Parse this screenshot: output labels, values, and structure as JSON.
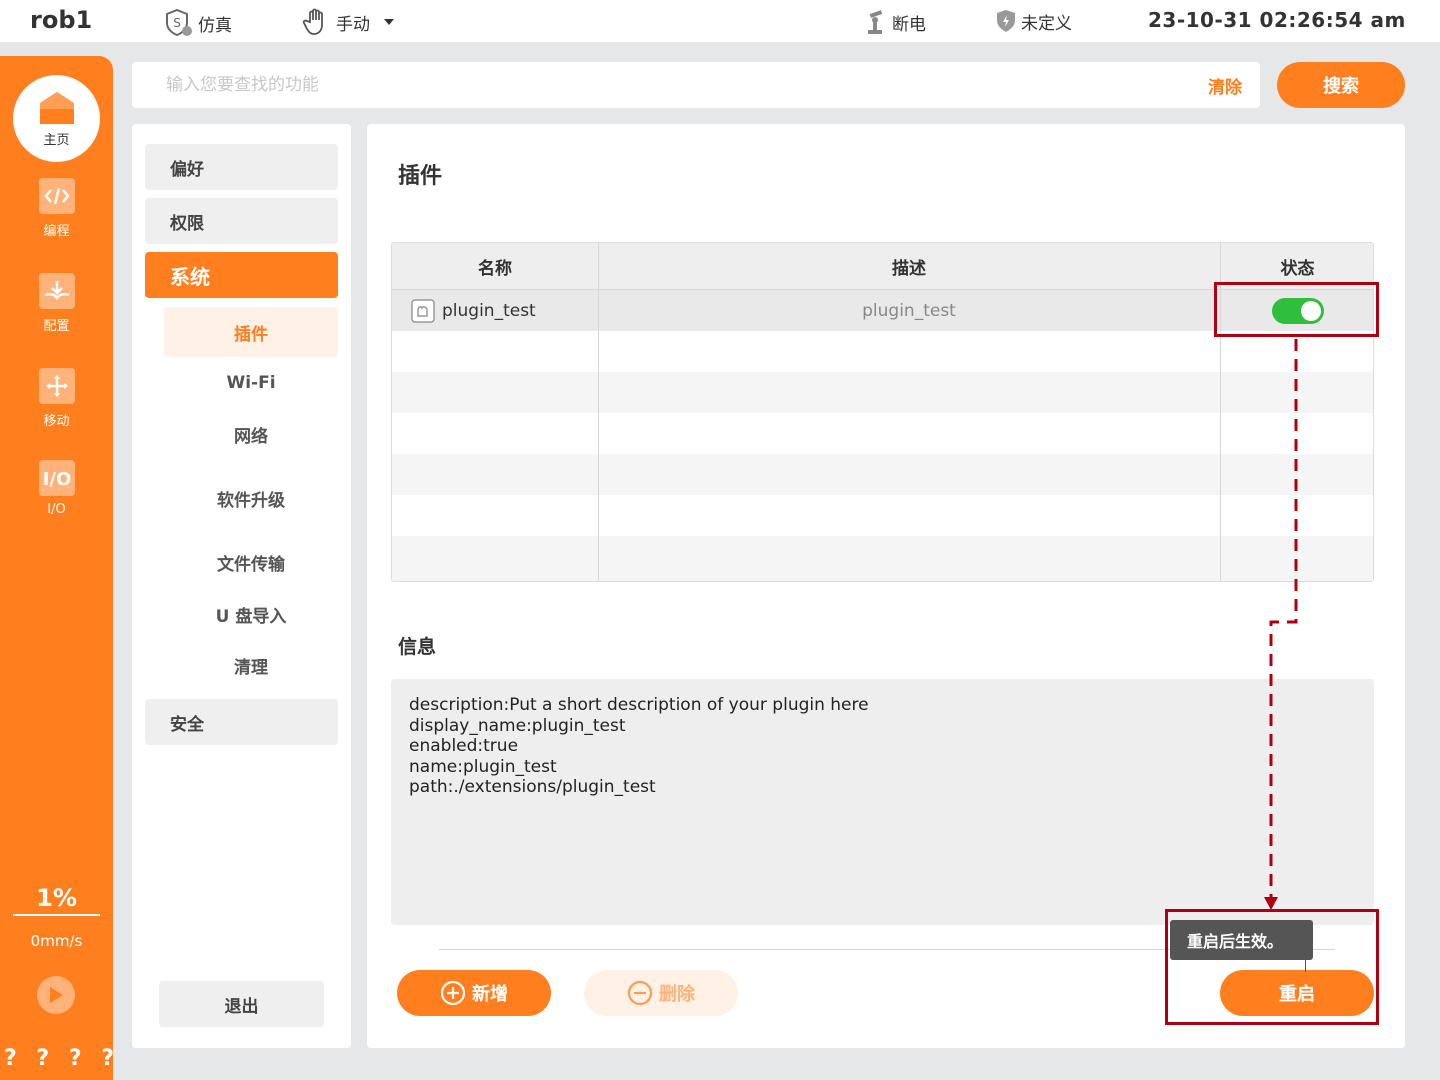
{
  "topbar": {
    "robot_name": "rob1",
    "sim_label": "仿真",
    "mode_label": "手动",
    "power_label": "断电",
    "safety_label": "未定义",
    "datetime": "23-10-31 02:26:54 am"
  },
  "leftnav": {
    "home": "主页",
    "items": [
      {
        "label": "编程",
        "icon": "code-icon"
      },
      {
        "label": "配置",
        "icon": "download-book-icon"
      },
      {
        "label": "移动",
        "icon": "move-arrows-icon"
      },
      {
        "label": "I/O",
        "icon": "io-icon"
      }
    ],
    "speed_percent": "1%",
    "speed_mm": "0mm/s",
    "bottom_marks": [
      "?",
      "?",
      "?",
      "?"
    ]
  },
  "search": {
    "placeholder": "输入您要查找的功能",
    "clear_label": "清除",
    "search_label": "搜索"
  },
  "menu": {
    "items": [
      "偏好",
      "权限",
      "系统",
      "安全"
    ],
    "subitems": [
      "插件",
      "Wi-Fi",
      "网络",
      "软件升级",
      "文件传输",
      "U 盘导入",
      "清理"
    ],
    "logout": "退出"
  },
  "main": {
    "title": "插件",
    "columns": [
      "名称",
      "描述",
      "状态"
    ],
    "rows": [
      {
        "name": "plugin_test",
        "description": "plugin_test",
        "enabled": true
      }
    ],
    "info_title": "信息",
    "info_lines": [
      "description:Put a short description of your plugin here",
      "display_name:plugin_test",
      "enabled:true",
      "name:plugin_test",
      "path:./extensions/plugin_test"
    ],
    "add_label": "新增",
    "delete_label": "删除",
    "restart_label": "重启",
    "tooltip": "重启后生效。"
  },
  "colors": {
    "accent": "#ff7f1e",
    "accent_light": "#fff1e5",
    "toggle_on": "#2fbf3c",
    "annotation": "#b00010"
  }
}
